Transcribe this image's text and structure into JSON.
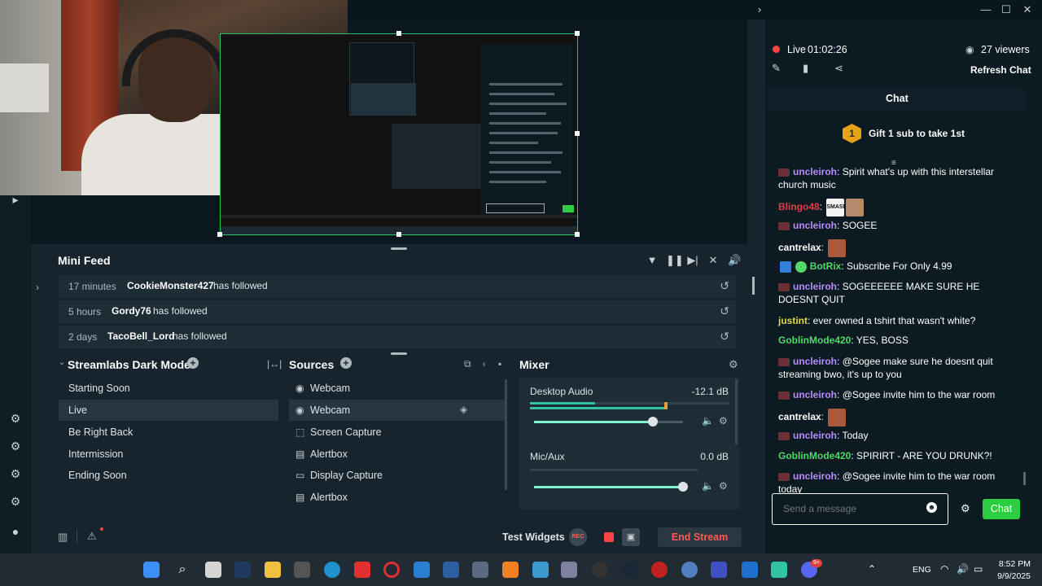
{
  "stream": {
    "live_label": "Live",
    "timer": "01:02:26",
    "viewers": "27 viewers",
    "refresh_chat": "Refresh Chat"
  },
  "minifeed": {
    "title": "Mini Feed",
    "items": [
      {
        "time": "17 minutes",
        "user": "CookieMonster427",
        "action": "has followed"
      },
      {
        "time": "5 hours",
        "user": "Gordy76",
        "action": "has followed"
      },
      {
        "time": "2 days",
        "user": "TacoBell_Lord",
        "action": "has followed"
      }
    ]
  },
  "scenes": {
    "title": "Streamlabs Dark Mode",
    "items": [
      "Starting Soon",
      "Live",
      "Be Right Back",
      "Intermission",
      "Ending Soon"
    ],
    "active": "Live"
  },
  "sources": {
    "title": "Sources",
    "items": [
      "Webcam",
      "Webcam",
      "Screen Capture",
      "Alertbox",
      "Display Capture",
      "Alertbox"
    ]
  },
  "mixer": {
    "title": "Mixer",
    "channels": [
      {
        "name": "Desktop Audio",
        "level": "-12.1 dB",
        "volume": 0.8
      },
      {
        "name": "Mic/Aux",
        "level": "0.0 dB",
        "volume": 1.0
      }
    ]
  },
  "bottom": {
    "test_widgets": "Test Widgets",
    "rec": "REC",
    "end_stream": "End Stream"
  },
  "chat": {
    "title": "Chat",
    "gift_count": "1",
    "gift_text": "Gift 1 sub to take 1st",
    "messages": [
      {
        "user": "uncleiroh",
        "text": "Spirit what's up with this interstellar church music",
        "color": "#b98cff"
      },
      {
        "user": "Blingo48",
        "text": "",
        "color": "#e23b4b"
      },
      {
        "user": "uncleiroh",
        "text": "SOGEE",
        "color": "#b98cff"
      },
      {
        "user": "cantrelax",
        "text": "",
        "color": "#ffffff"
      },
      {
        "user": "BotRix",
        "text": "Subscribe For Only 4.99",
        "color": "#53d769"
      },
      {
        "user": "uncleiroh",
        "text": "SOGEEEEEE MAKE SURE HE DOESNT QUIT",
        "color": "#b98cff"
      },
      {
        "user": "justint",
        "text": "ever owned a tshirt that wasn't white?",
        "color": "#e0d94a"
      },
      {
        "user": "GoblinMode420",
        "text": "YES, BOSS",
        "color": "#53d769"
      },
      {
        "user": "uncleiroh",
        "text": "@Sogee make sure he doesnt quit streaming bwo, it's up to you",
        "color": "#b98cff"
      },
      {
        "user": "uncleiroh",
        "text": "@Sogee invite him to the war room",
        "color": "#b98cff"
      },
      {
        "user": "cantrelax",
        "text": "",
        "color": "#ffffff"
      },
      {
        "user": "uncleiroh",
        "text": "Today",
        "color": "#b98cff"
      },
      {
        "user": "GoblinMode420",
        "text": "SPIRIRT - ARE YOU DRUNK?!",
        "color": "#53d769"
      },
      {
        "user": "uncleiroh",
        "text": "@Sogee invite him to the war room today",
        "color": "#b98cff"
      }
    ],
    "input_placeholder": "Send a message",
    "send_label": "Chat"
  },
  "emote_texts": {
    "smash": "SMASH"
  },
  "taskbar": {
    "language": "ENG",
    "time": "8:52 PM",
    "date": "9/9/2025",
    "discord_badge": "9+"
  },
  "colors": {
    "accent": "#31c3a2",
    "live_red": "#ff4444",
    "chat_button": "#2ecc40"
  }
}
